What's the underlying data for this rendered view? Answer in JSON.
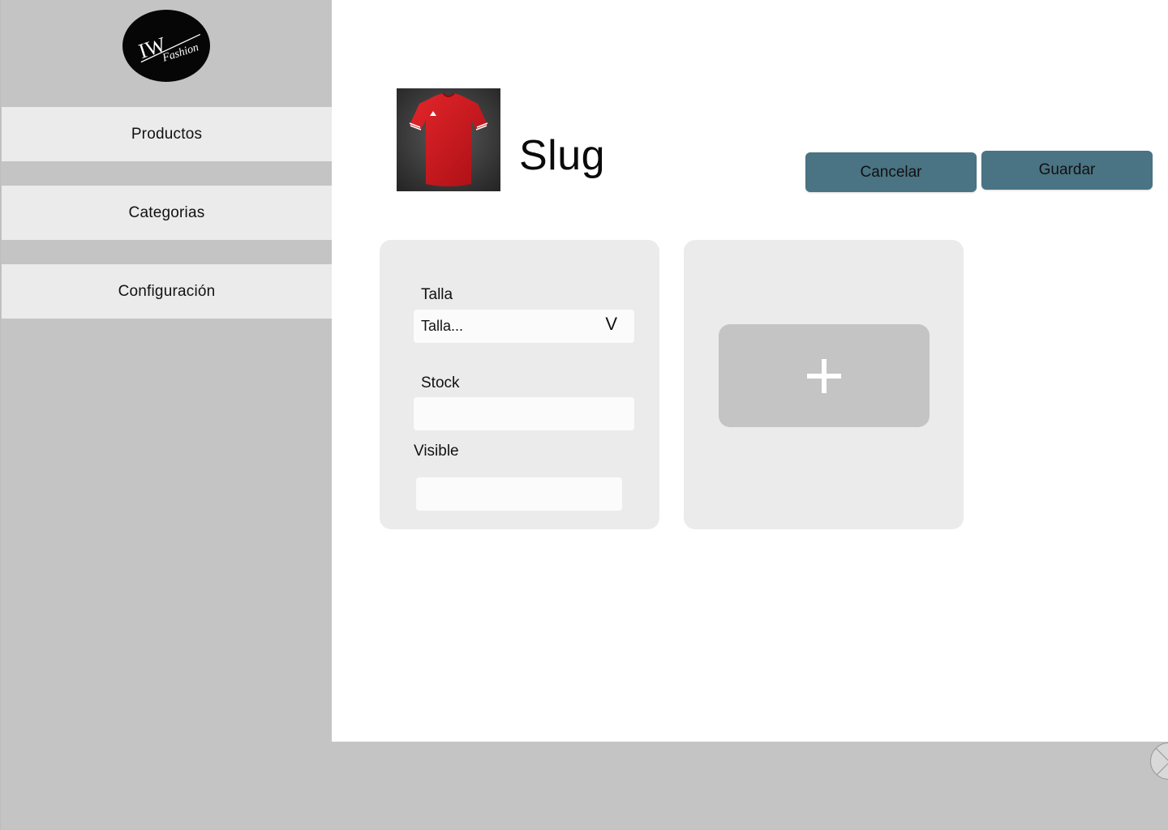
{
  "logo": {
    "primary": "IW",
    "secondary": "Fashion"
  },
  "sidebar": {
    "items": [
      {
        "label": "Productos"
      },
      {
        "label": "Categorias"
      },
      {
        "label": "Configuración"
      }
    ]
  },
  "header": {
    "title": "Slug",
    "cancel_label": "Cancelar",
    "save_label": "Guardar"
  },
  "form": {
    "talla_label": "Talla",
    "talla_value": "Talla...",
    "talla_chevron": "V",
    "stock_label": "Stock",
    "stock_value": "",
    "visible_label": "Visible",
    "visible_value": ""
  },
  "icons": {
    "add_image": "plus-icon",
    "corner": "close-icon"
  },
  "colors": {
    "accent": "#4a7383",
    "sidebar_bg": "#c4c4c4",
    "card_bg": "#ebebeb",
    "product": "#d11a1f"
  }
}
